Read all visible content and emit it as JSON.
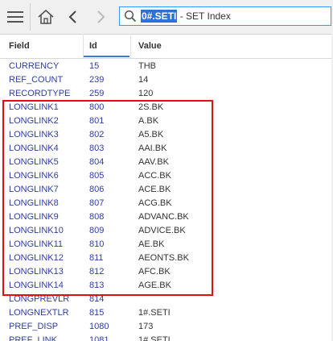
{
  "toolbar": {
    "menu_icon": "hamburger-menu-icon",
    "home_icon": "home-icon",
    "back_icon": "chevron-left-icon",
    "forward_icon": "chevron-right-icon",
    "search_icon": "search-icon",
    "search_selected": "0#.SETI",
    "search_rest": " - SET Index"
  },
  "table": {
    "columns": [
      "Field",
      "Id",
      "Value"
    ],
    "rows": [
      {
        "field": "CURRENCY",
        "id": "15",
        "value": "THB"
      },
      {
        "field": "REF_COUNT",
        "id": "239",
        "value": "14"
      },
      {
        "field": "RECORDTYPE",
        "id": "259",
        "value": "120"
      },
      {
        "field": "LONGLINK1",
        "id": "800",
        "value": "2S.BK"
      },
      {
        "field": "LONGLINK2",
        "id": "801",
        "value": "A.BK"
      },
      {
        "field": "LONGLINK3",
        "id": "802",
        "value": "A5.BK"
      },
      {
        "field": "LONGLINK4",
        "id": "803",
        "value": "AAI.BK"
      },
      {
        "field": "LONGLINK5",
        "id": "804",
        "value": "AAV.BK"
      },
      {
        "field": "LONGLINK6",
        "id": "805",
        "value": "ACC.BK"
      },
      {
        "field": "LONGLINK7",
        "id": "806",
        "value": "ACE.BK"
      },
      {
        "field": "LONGLINK8",
        "id": "807",
        "value": "ACG.BK"
      },
      {
        "field": "LONGLINK9",
        "id": "808",
        "value": "ADVANC.BK"
      },
      {
        "field": "LONGLINK10",
        "id": "809",
        "value": "ADVICE.BK"
      },
      {
        "field": "LONGLINK11",
        "id": "810",
        "value": "AE.BK"
      },
      {
        "field": "LONGLINK12",
        "id": "811",
        "value": "AEONTS.BK"
      },
      {
        "field": "LONGLINK13",
        "id": "812",
        "value": "AFC.BK"
      },
      {
        "field": "LONGLINK14",
        "id": "813",
        "value": "AGE.BK"
      },
      {
        "field": "LONGPREVLR",
        "id": "814",
        "value": ""
      },
      {
        "field": "LONGNEXTLR",
        "id": "815",
        "value": "1#.SETI"
      },
      {
        "field": "PREF_DISP",
        "id": "1080",
        "value": "173"
      },
      {
        "field": "PREF_LINK",
        "id": "1081",
        "value": "1#.SETI"
      }
    ]
  },
  "colors": {
    "field_text": "#2f3e9e",
    "value_text": "#333333",
    "highlight_border": "#e01010",
    "search_selection": "#2f6fd6"
  }
}
